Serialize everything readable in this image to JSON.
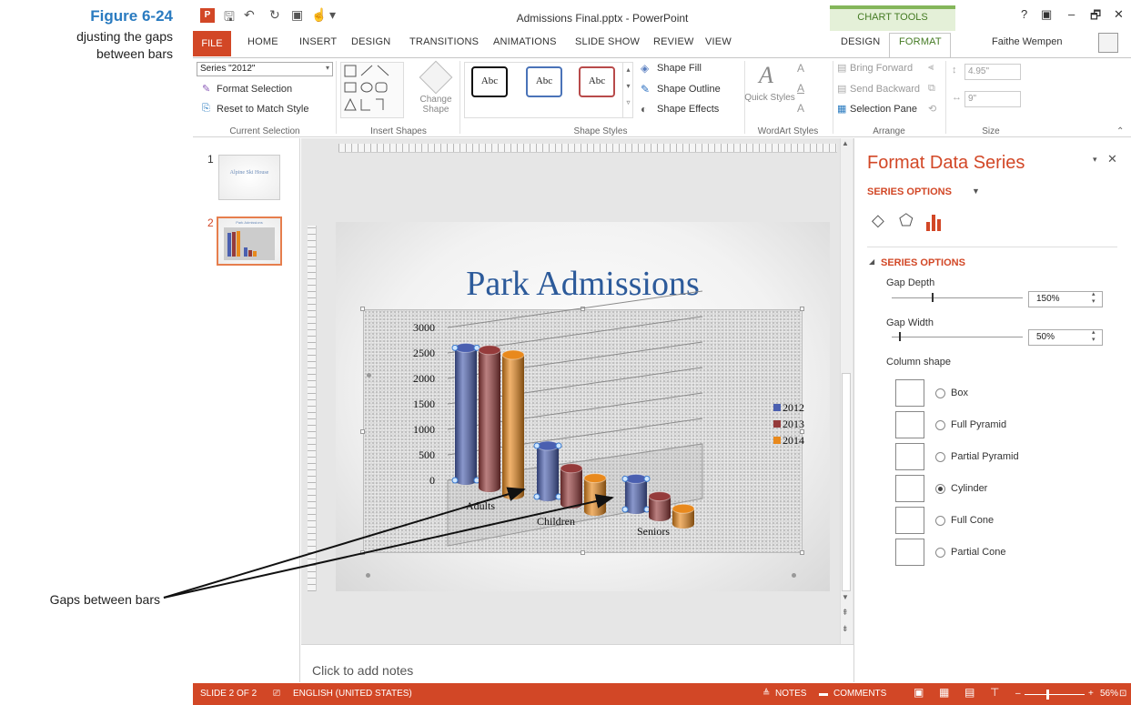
{
  "figure": {
    "number": "Figure 6-24",
    "caption": "djusting the gaps\nbetween bars",
    "gap_callout": "Gaps between bars"
  },
  "titlebar": {
    "document_title": "Admissions Final.pptx - PowerPoint",
    "context_label": "CHART TOOLS",
    "controls": [
      "?",
      "▣",
      "–",
      "🗗",
      "✕"
    ]
  },
  "tabs": {
    "file": "FILE",
    "items": [
      "HOME",
      "INSERT",
      "DESIGN",
      "TRANSITIONS",
      "ANIMATIONS",
      "SLIDE SHOW",
      "REVIEW",
      "VIEW"
    ],
    "context_items": [
      "DESIGN",
      "FORMAT"
    ],
    "active": "FORMAT",
    "user": "Faithe Wempen"
  },
  "ribbon": {
    "current_selection": {
      "dropdown_value": "Series \"2012\"",
      "format_selection": "Format Selection",
      "reset_to_match_style": "Reset to Match Style",
      "group_label": "Current Selection"
    },
    "insert_shapes": {
      "change_shape": "Change Shape",
      "group_label": "Insert Shapes"
    },
    "shape_styles": {
      "swatch_label": "Abc",
      "shape_fill": "Shape Fill",
      "shape_outline": "Shape Outline",
      "shape_effects": "Shape Effects",
      "group_label": "Shape Styles"
    },
    "wordart": {
      "quick_styles": "Quick Styles",
      "group_label": "WordArt Styles"
    },
    "arrange": {
      "bring_forward": "Bring Forward",
      "send_backward": "Send Backward",
      "selection_pane": "Selection Pane",
      "group_label": "Arrange"
    },
    "size": {
      "height": "4.95\"",
      "width": "9\"",
      "group_label": "Size"
    }
  },
  "thumbnails": [
    {
      "number": "1",
      "title": "Alpine Ski House"
    },
    {
      "number": "2",
      "title": "Park Admissions"
    }
  ],
  "slide": {
    "title": "Park Admissions"
  },
  "chart_data": {
    "type": "bar",
    "title": "Park Admissions",
    "categories": [
      "Adults",
      "Children",
      "Seniors"
    ],
    "series": [
      {
        "name": "2012",
        "values": [
          2600,
          1000,
          600
        ]
      },
      {
        "name": "2013",
        "values": [
          2700,
          700,
          400
        ]
      },
      {
        "name": "2014",
        "values": [
          2750,
          650,
          300
        ]
      }
    ],
    "y_ticks": [
      "3000",
      "2500",
      "2000",
      "1500",
      "1000",
      "500",
      "0"
    ],
    "ylim": [
      0,
      3000
    ],
    "legend_position": "right",
    "colors": [
      "#4a5fb0",
      "#953b3b",
      "#e8891d"
    ],
    "style": "3d-cylinder"
  },
  "format_pane": {
    "title": "Format Data Series",
    "series_options_menu": "SERIES OPTIONS",
    "section": "SERIES OPTIONS",
    "gap_depth_label": "Gap Depth",
    "gap_depth_value": "150%",
    "gap_width_label": "Gap Width",
    "gap_width_value": "50%",
    "column_shape_label": "Column shape",
    "shapes": [
      {
        "label": "Box",
        "selected": false
      },
      {
        "label": "Full Pyramid",
        "selected": false
      },
      {
        "label": "Partial Pyramid",
        "selected": false
      },
      {
        "label": "Cylinder",
        "selected": true
      },
      {
        "label": "Full Cone",
        "selected": false
      },
      {
        "label": "Partial Cone",
        "selected": false
      }
    ]
  },
  "notes": {
    "placeholder": "Click to add notes"
  },
  "statusbar": {
    "slide_info": "SLIDE 2 OF 2",
    "language": "ENGLISH (UNITED STATES)",
    "notes": "NOTES",
    "comments": "COMMENTS",
    "zoom": "56%"
  }
}
